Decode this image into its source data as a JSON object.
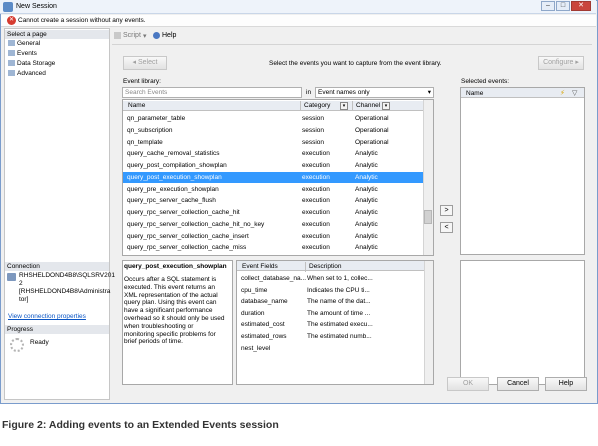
{
  "window": {
    "title": "New Session",
    "buttons": [
      "–",
      "□",
      "✕"
    ]
  },
  "error": {
    "text": "Cannot create a session without any events."
  },
  "sidebar": {
    "select_page_header": "Select a page",
    "pages": [
      {
        "label": "General"
      },
      {
        "label": "Events"
      },
      {
        "label": "Data Storage"
      },
      {
        "label": "Advanced"
      }
    ],
    "connection_header": "Connection",
    "connection_line1": "RHSHELDOND4B8\\SQLSRV201",
    "connection_line2": "2",
    "connection_line3": "[RHSHELDOND4B8\\Administra",
    "connection_line4": "tor]",
    "connection_link": "View connection properties",
    "progress_header": "Progress",
    "progress_status": "Ready"
  },
  "toolbar": {
    "script_label": "Script",
    "help_label": "Help"
  },
  "events_page": {
    "select_button": "Select",
    "instruction": "Select the events you want to capture from the event library.",
    "configure_button": "Configure",
    "library_label": "Event library:",
    "search_placeholder": "Search Events",
    "in_label": "in",
    "filter_value": "Event names only",
    "columns": {
      "name": "Name",
      "category": "Category",
      "channel": "Channel"
    },
    "rows": [
      {
        "name": "qn_parameter_table",
        "category": "session",
        "channel": "Operational",
        "selected": false
      },
      {
        "name": "qn_subscription",
        "category": "session",
        "channel": "Operational",
        "selected": false
      },
      {
        "name": "qn_template",
        "category": "session",
        "channel": "Operational",
        "selected": false
      },
      {
        "name": "query_cache_removal_statistics",
        "category": "execution",
        "channel": "Analytic",
        "selected": false
      },
      {
        "name": "query_post_compilation_showplan",
        "category": "execution",
        "channel": "Analytic",
        "selected": false
      },
      {
        "name": "query_post_execution_showplan",
        "category": "execution",
        "channel": "Analytic",
        "selected": true
      },
      {
        "name": "query_pre_execution_showplan",
        "category": "execution",
        "channel": "Analytic",
        "selected": false
      },
      {
        "name": "query_rpc_server_cache_flush",
        "category": "execution",
        "channel": "Analytic",
        "selected": false
      },
      {
        "name": "query_rpc_server_collection_cache_hit",
        "category": "execution",
        "channel": "Analytic",
        "selected": false
      },
      {
        "name": "query_rpc_server_collection_cache_hit_no_key",
        "category": "execution",
        "channel": "Analytic",
        "selected": false
      },
      {
        "name": "query_rpc_server_collection_cache_insert",
        "category": "execution",
        "channel": "Analytic",
        "selected": false
      },
      {
        "name": "query_rpc_server_collection_cache_miss",
        "category": "execution",
        "channel": "Analytic",
        "selected": false
      }
    ],
    "desc_title": "query_post_execution_showplan",
    "desc_lines": [
      "Occurs after a SQL statement is",
      "executed. This event returns an",
      "XML representation of the actual",
      "query plan. Using this event can",
      "have a significant performance",
      "overhead so it should only be used",
      "when troubleshooting or",
      "monitoring specific problems for",
      "brief periods of time."
    ],
    "fields_columns": {
      "field": "Event Fields",
      "description": "Description"
    },
    "fields": [
      {
        "field": "collect_database_na...",
        "description": "When set to 1, collec..."
      },
      {
        "field": "cpu_time",
        "description": "Indicates the CPU ti..."
      },
      {
        "field": "database_name",
        "description": "The name of the dat..."
      },
      {
        "field": "duration",
        "description": "The amount of time ..."
      },
      {
        "field": "estimated_cost",
        "description": "The estimated execu..."
      },
      {
        "field": "estimated_rows",
        "description": "The estimated numb..."
      },
      {
        "field": "nest_level",
        "description": ""
      }
    ],
    "selected_events_label": "Selected events:",
    "selected_columns": {
      "name": "Name"
    },
    "add_arrow": ">",
    "remove_arrow": "<"
  },
  "footer": {
    "ok": "OK",
    "cancel": "Cancel",
    "help": "Help"
  },
  "caption": "Figure 2: Adding events to an Extended Events session",
  "colors": {
    "selection": "#3399ff",
    "error": "#d63b2f",
    "link": "#0a55c4"
  }
}
